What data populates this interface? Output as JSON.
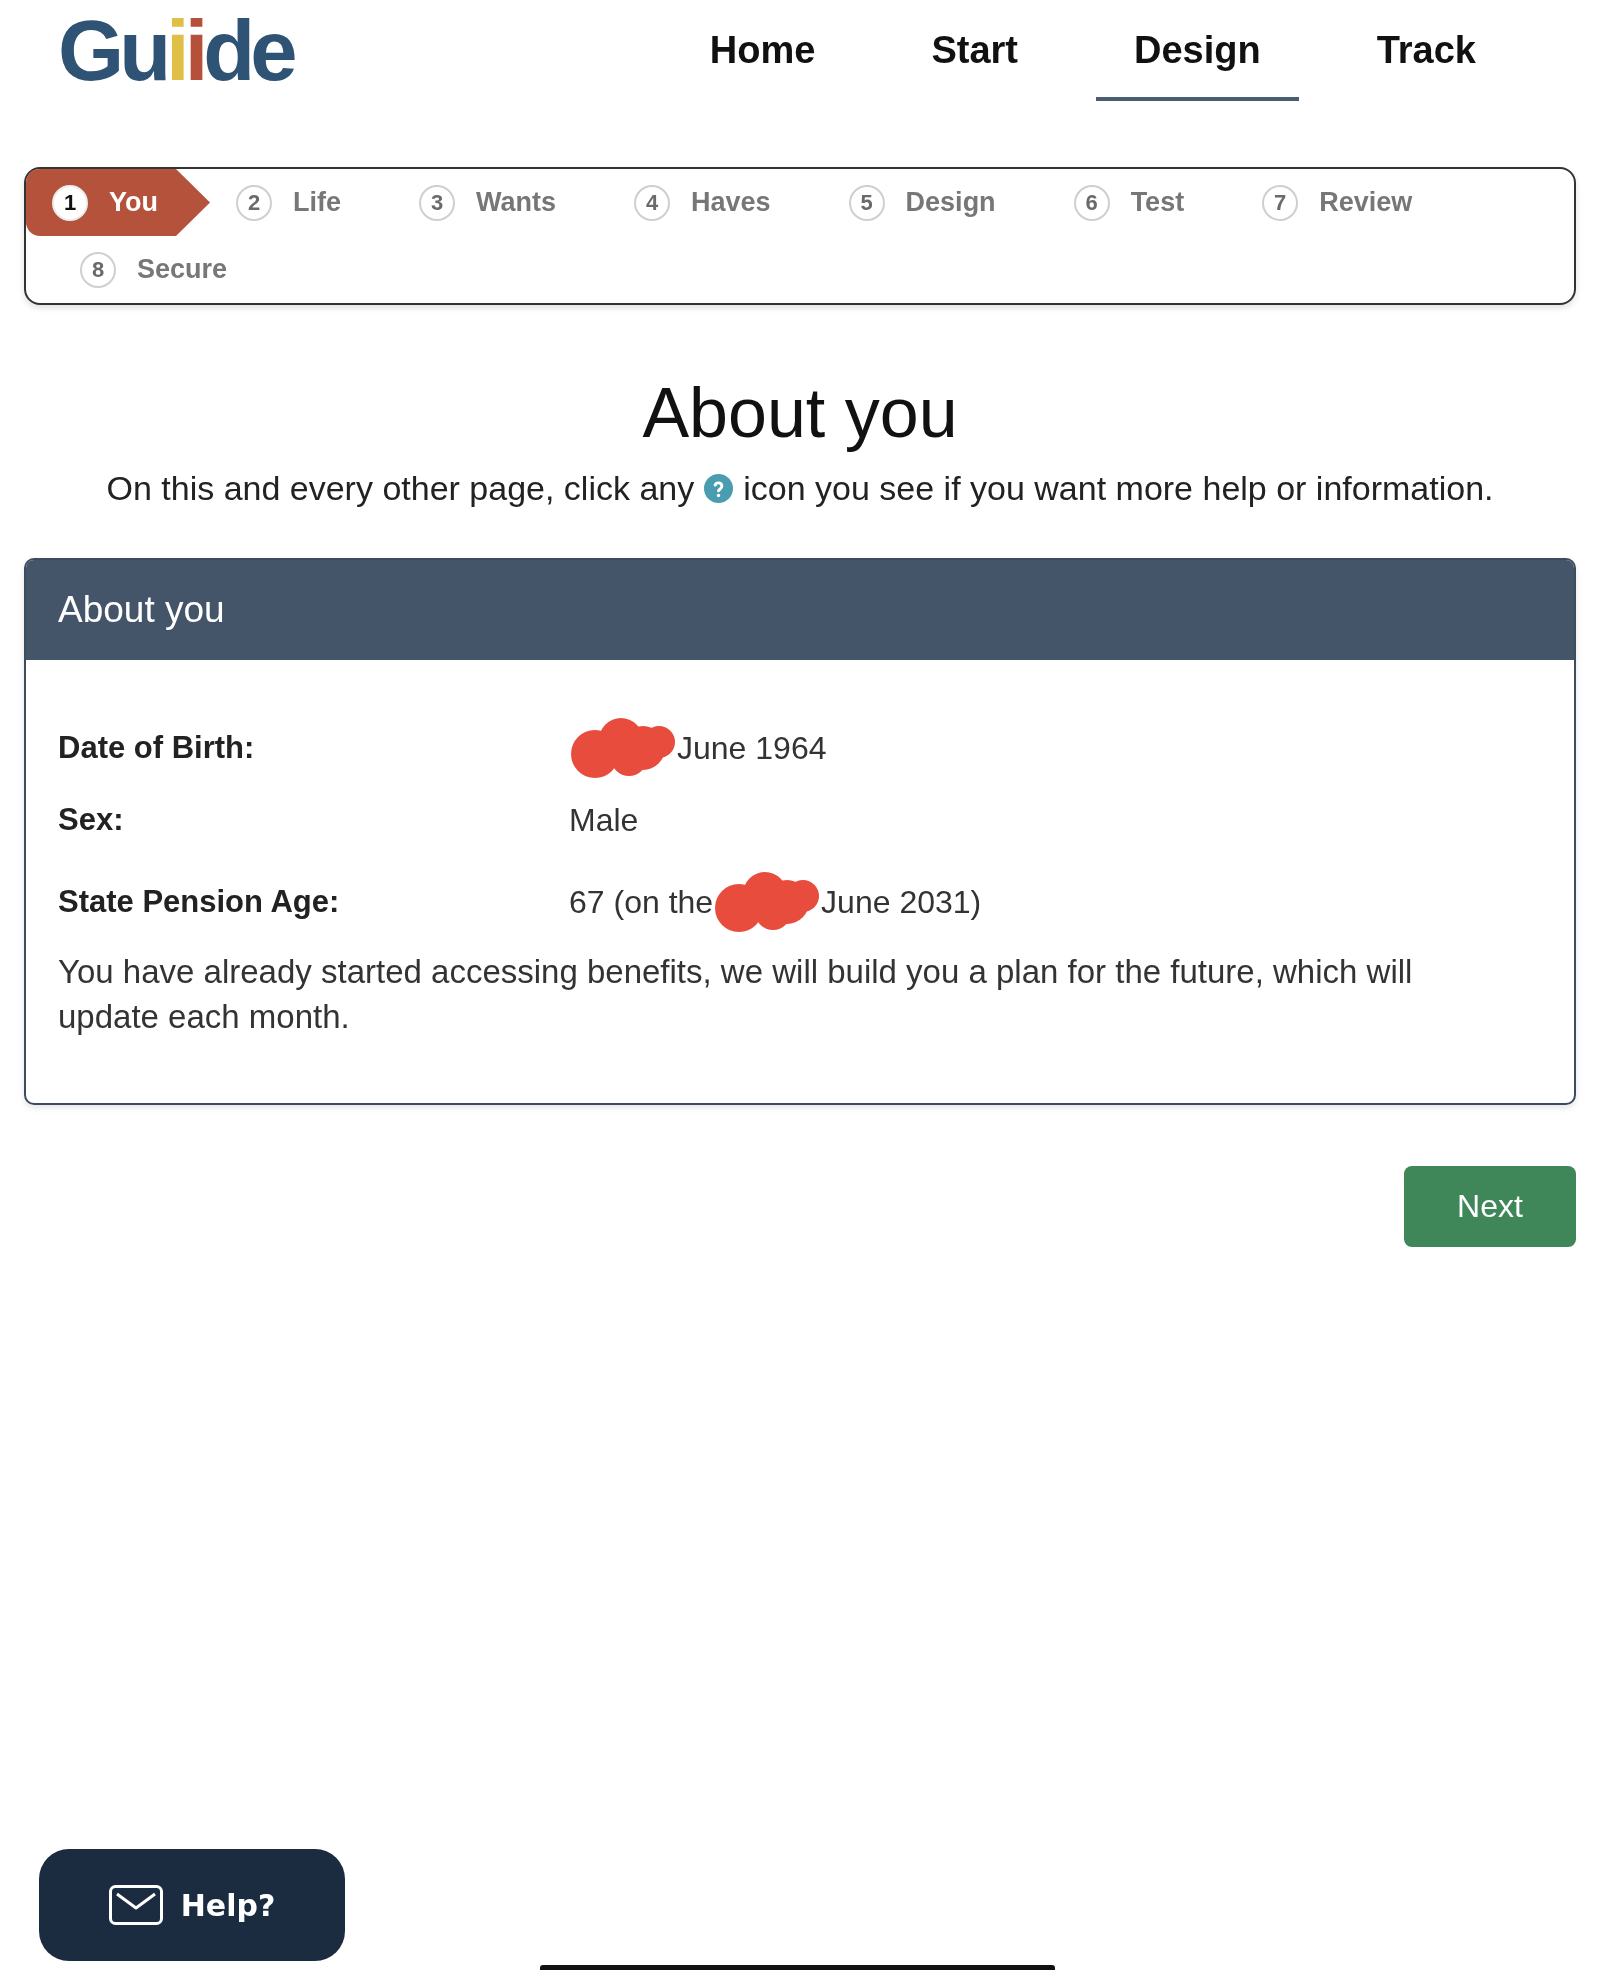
{
  "logo": "Guiide",
  "nav": [
    {
      "label": "Home",
      "selected": false
    },
    {
      "label": "Start",
      "selected": false
    },
    {
      "label": "Design",
      "selected": true
    },
    {
      "label": "Track",
      "selected": false
    }
  ],
  "steps": [
    {
      "number": "1",
      "label": "You",
      "selected": true
    },
    {
      "number": "2",
      "label": "Life",
      "selected": false
    },
    {
      "number": "3",
      "label": "Wants",
      "selected": false
    },
    {
      "number": "4",
      "label": "Haves",
      "selected": false
    },
    {
      "number": "5",
      "label": "Design",
      "selected": false
    },
    {
      "number": "6",
      "label": "Test",
      "selected": false
    },
    {
      "number": "7",
      "label": "Review",
      "selected": false
    },
    {
      "number": "8",
      "label": "Secure",
      "selected": false
    }
  ],
  "title": "About you",
  "intro": {
    "before_icon": "On this and every other page, click any",
    "after_icon": "icon you see if you want more help or information."
  },
  "card": {
    "title": "About you",
    "rows": [
      {
        "label": "Date of Birth:",
        "segments": [
          {
            "kind": "redaction"
          },
          {
            "kind": "text",
            "text": "June 1964"
          }
        ]
      },
      {
        "label": "Sex:",
        "segments": [
          {
            "kind": "text",
            "text": "Male"
          }
        ]
      },
      {
        "label": "State Pension Age:",
        "segments": [
          {
            "kind": "text",
            "text": "67 (on the"
          },
          {
            "kind": "redaction"
          },
          {
            "kind": "text",
            "text": "June 2031)"
          }
        ]
      }
    ],
    "note": "You have already started accessing benefits, we will build you a plan for the future, which will update each month."
  },
  "next_button": "Next",
  "help_button": "Help?"
}
